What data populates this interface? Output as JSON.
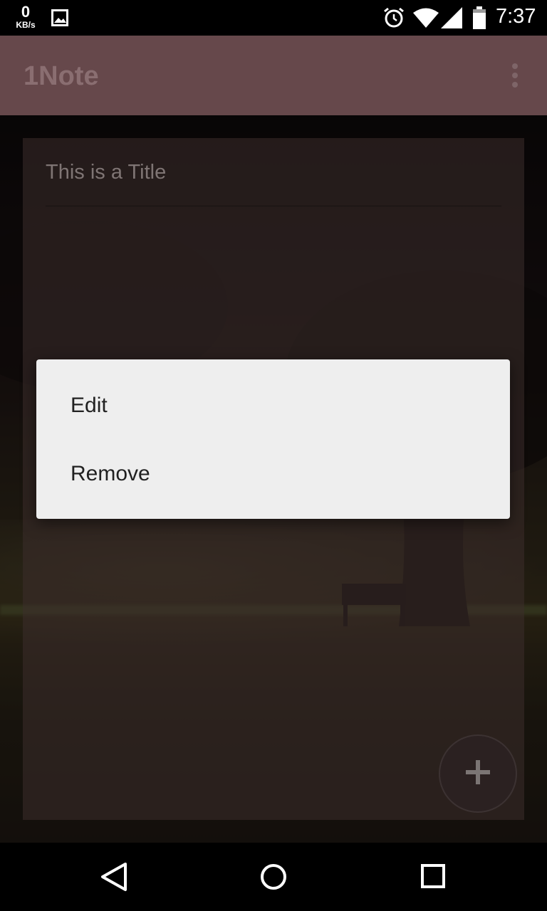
{
  "status_bar": {
    "net_speed_value": "0",
    "net_speed_unit": "KB/s",
    "time": "7:37",
    "icons": [
      "gallery-icon",
      "alarm-icon",
      "wifi-icon",
      "signal-icon",
      "battery-icon"
    ]
  },
  "app_bar": {
    "title": "1Note",
    "menu_icon": "more-vert-icon"
  },
  "note": {
    "title": "This is a Title"
  },
  "context_menu": {
    "items": [
      {
        "label": "Edit"
      },
      {
        "label": "Remove"
      }
    ]
  },
  "fab": {
    "icon": "plus-icon"
  },
  "nav_bar": {
    "icons": [
      "back-icon",
      "home-icon",
      "recents-icon"
    ]
  },
  "colors": {
    "app_bar": "#66484b",
    "dialog_bg": "#eeeeee",
    "dialog_text": "#212121"
  }
}
